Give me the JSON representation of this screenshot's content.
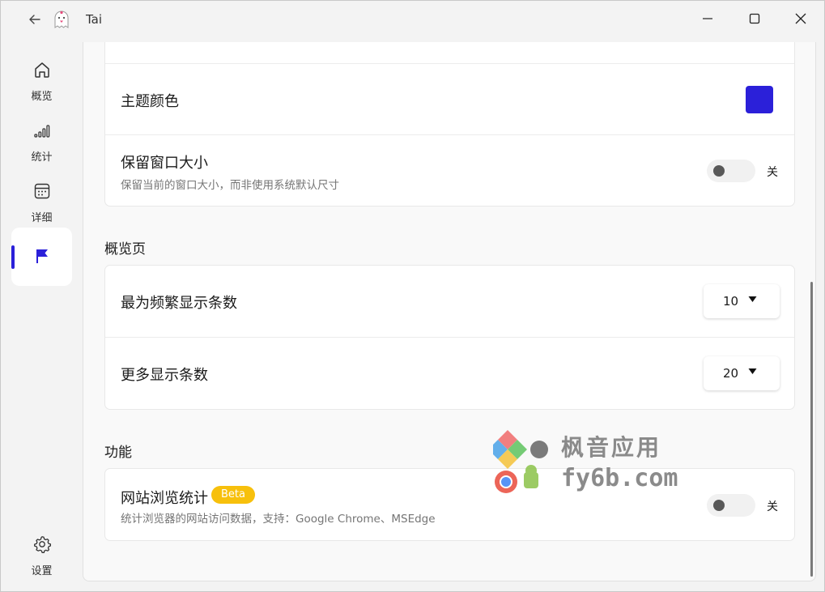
{
  "window": {
    "title": "Tai"
  },
  "sidebar": {
    "items": [
      {
        "label": "概览",
        "icon": "home-icon"
      },
      {
        "label": "统计",
        "icon": "bar-chart-icon"
      },
      {
        "label": "详细",
        "icon": "calendar-icon"
      },
      {
        "label": "",
        "icon": "flag-icon",
        "active": true
      }
    ],
    "settings": {
      "label": "设置",
      "icon": "gear-icon"
    }
  },
  "settings": {
    "appearance": {
      "theme_color": {
        "title": "主题颜色",
        "value": "#2b20d9"
      },
      "keep_window_size": {
        "title": "保留窗口大小",
        "description": "保留当前的窗口大小，而非使用系统默认尺寸",
        "enabled": false,
        "state_text": "关"
      }
    },
    "overview": {
      "section_title": "概览页",
      "frequent_count": {
        "title": "最为频繁显示条数",
        "value": "10"
      },
      "more_count": {
        "title": "更多显示条数",
        "value": "20"
      }
    },
    "features": {
      "section_title": "功能",
      "web_stats": {
        "title": "网站浏览统计",
        "badge": "Beta",
        "description": "统计浏览器的网站访问数据，支持：Google Chrome、MSEdge",
        "enabled": false,
        "state_text": "关"
      }
    }
  },
  "watermark": {
    "line1": "枫音应用",
    "line2": "fy6b.com"
  },
  "colors": {
    "accent": "#2b20d9",
    "badge": "#f7c00c"
  }
}
